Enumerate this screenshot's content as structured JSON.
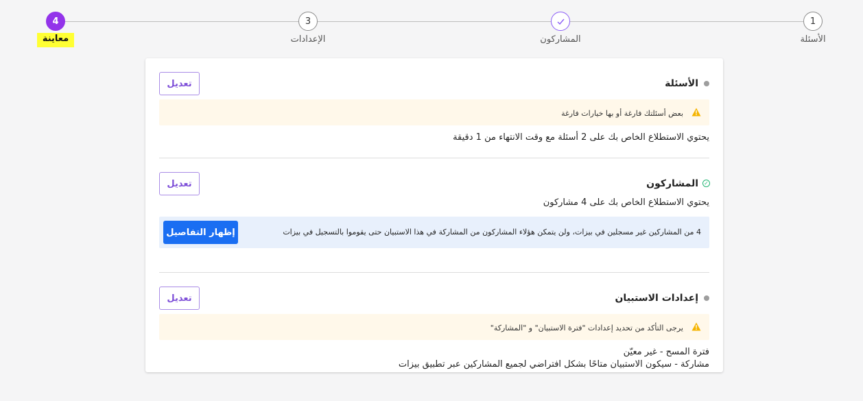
{
  "stepper": {
    "steps": [
      {
        "number": "1",
        "label": "الأسئلة",
        "state": "inactive"
      },
      {
        "number": "",
        "label": "المشاركون",
        "state": "done"
      },
      {
        "number": "3",
        "label": "الإعدادات",
        "state": "inactive"
      },
      {
        "number": "4",
        "label": "معاينة",
        "state": "active"
      }
    ]
  },
  "questions": {
    "title": "الأسئلة",
    "edit_label": "تعديل",
    "warning": "بعض أسئلتك فارغة أو بها خيارات فارغة",
    "summary": "يحتوي الاستطلاع الخاص بك على 2 أسئلة مع وقت الانتهاء من 1 دقيقة"
  },
  "participants": {
    "title": "المشاركون",
    "edit_label": "تعديل",
    "summary": "يحتوي الاستطلاع الخاص بك على 4 مشاركون",
    "info": "4 من المشاركين غير مسجلين في بيزات، ولن يتمكن هؤلاء المشاركون من المشاركة في هذا الاستبيان حتى يقوموا بالتسجيل في بيزات",
    "details_label": "إظهار التفاصيل"
  },
  "settings": {
    "title": "إعدادات الاستبيان",
    "edit_label": "تعديل",
    "warning": "يرجى التأكد من تحديد إعدادات \"فترة الاستبيان\" و \"المشاركة\"",
    "period_text": "فترة المسح - غير معيّن",
    "participation_text": "مشاركة - سيكون الاستبيان متاحًا بشكل افتراضي لجميع المشاركين عبر تطبيق بيزات"
  },
  "colors": {
    "accent": "#9333ea",
    "primary_button": "#1a6ef2",
    "warning_bg": "#fff8ea",
    "info_bg": "#e8f0fc",
    "highlight": "#ffff33"
  }
}
